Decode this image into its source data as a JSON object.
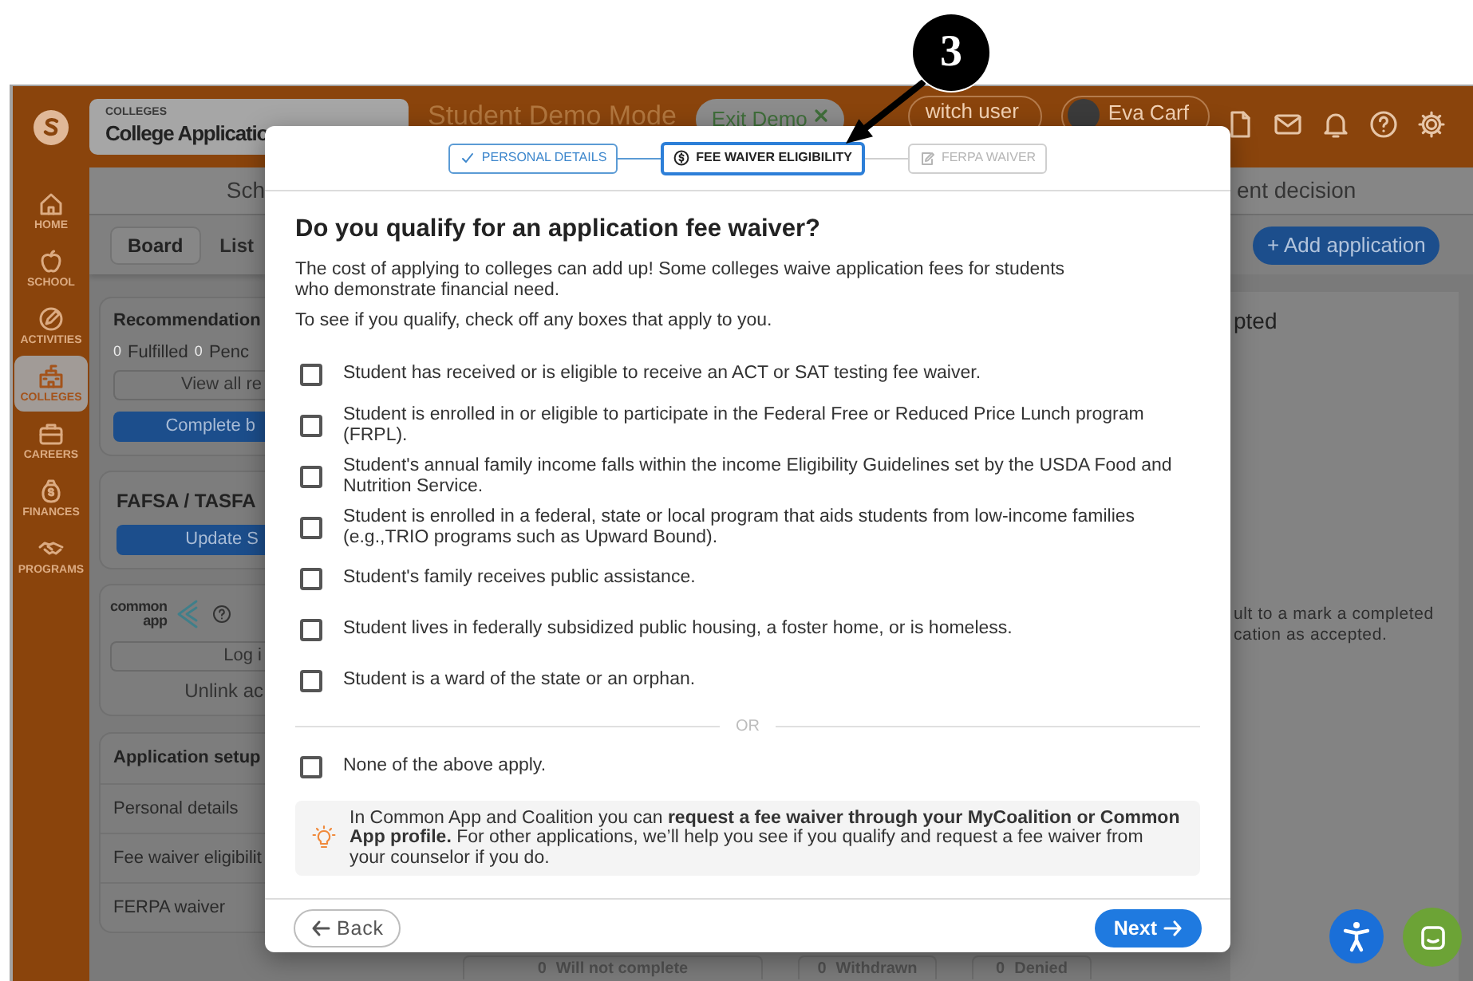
{
  "top_bar": {
    "section_label": "COLLEGES",
    "section_title": "College Applicatio",
    "mode_title": "Student Demo Mode",
    "exit_button": "Exit Demo",
    "switch_button": "witch user",
    "user_name": "Eva Carf"
  },
  "sidebar": {
    "items": [
      {
        "label": "HOME",
        "selected": false
      },
      {
        "label": "SCHOOL",
        "selected": false
      },
      {
        "label": "ACTIVITIES",
        "selected": false
      },
      {
        "label": "COLLEGES",
        "selected": true
      },
      {
        "label": "CAREERS",
        "selected": false
      },
      {
        "label": "FINANCES",
        "selected": false
      },
      {
        "label": "PROGRAMS",
        "selected": false
      }
    ]
  },
  "left_panel": {
    "header": "Sch",
    "view_tabs": [
      {
        "label": "Board",
        "selected": true
      },
      {
        "label": "List",
        "selected": false
      }
    ],
    "recommendation": {
      "title": "Recommendation",
      "counts": [
        {
          "count": "0",
          "label": "Fulfilled"
        },
        {
          "count": "0",
          "label": "Penc"
        }
      ],
      "view_button": "View all re",
      "complete_button": "Complete b"
    },
    "fafsa": {
      "title": "FAFSA / TASFA",
      "button": "Update S"
    },
    "common_app": {
      "logo_lines": [
        "common",
        "app"
      ],
      "log_in_button": "Log i",
      "unlink_link": "Unlink ac"
    },
    "setup": {
      "title": "Application setup",
      "items": [
        "Personal details",
        "Fee waiver eligibilit",
        "FERPA waiver"
      ]
    }
  },
  "right_panel": {
    "header": "ent decision",
    "add_button": "+ Add application",
    "column_title": "pted",
    "hint_lines": [
      "ult to a mark a completed",
      "cation as accepted."
    ]
  },
  "status_counts": [
    {
      "count": "0",
      "label": "Will not complete"
    },
    {
      "count": "0",
      "label": "Withdrawn"
    },
    {
      "count": "0",
      "label": "Denied"
    }
  ],
  "modal": {
    "steps": [
      {
        "label": "PERSONAL DETAILS",
        "selected": false,
        "completed": true
      },
      {
        "label": "FEE WAIVER ELIGIBILITY",
        "selected": true,
        "completed": false
      },
      {
        "label": "FERPA WAIVER",
        "selected": false,
        "completed": false
      }
    ],
    "title": "Do you qualify for an application fee waiver?",
    "intro": [
      "The cost of applying to colleges can add up! Some colleges waive application fees for students who demonstrate financial need.",
      "To see if you qualify, check off any boxes that apply to you."
    ],
    "options": [
      {
        "label": "Student has received or is eligible to receive an ACT or SAT testing fee waiver.",
        "checked": false
      },
      {
        "label": "Student is enrolled in or eligible to participate in the Federal Free or Reduced Price Lunch program (FRPL).",
        "checked": false
      },
      {
        "label": "Student's annual family income falls within the income Eligibility Guidelines set by the USDA Food and Nutrition Service.",
        "checked": false
      },
      {
        "label": "Student is enrolled in a federal, state or local program that aids students from low-income families (e.g.,TRIO programs such as Upward Bound).",
        "checked": false
      },
      {
        "label": "Student's family receives public assistance.",
        "checked": false
      },
      {
        "label": "Student lives in federally subsidized public housing, a foster home, or is homeless.",
        "checked": false
      },
      {
        "label": "Student is a ward of the state or an orphan.",
        "checked": false
      }
    ],
    "divider": "OR",
    "none_option": {
      "label": "None of the above apply.",
      "checked": false
    },
    "tip": "In Common App and Coalition you can **request a fee waiver through your MyCoalition or Common App profile.** For other applications, we’ll help you see if you qualify and request a fee waiver from your counselor if you do.",
    "back_button": "Back",
    "next_button": "Next"
  },
  "callout": {
    "number": "3"
  }
}
